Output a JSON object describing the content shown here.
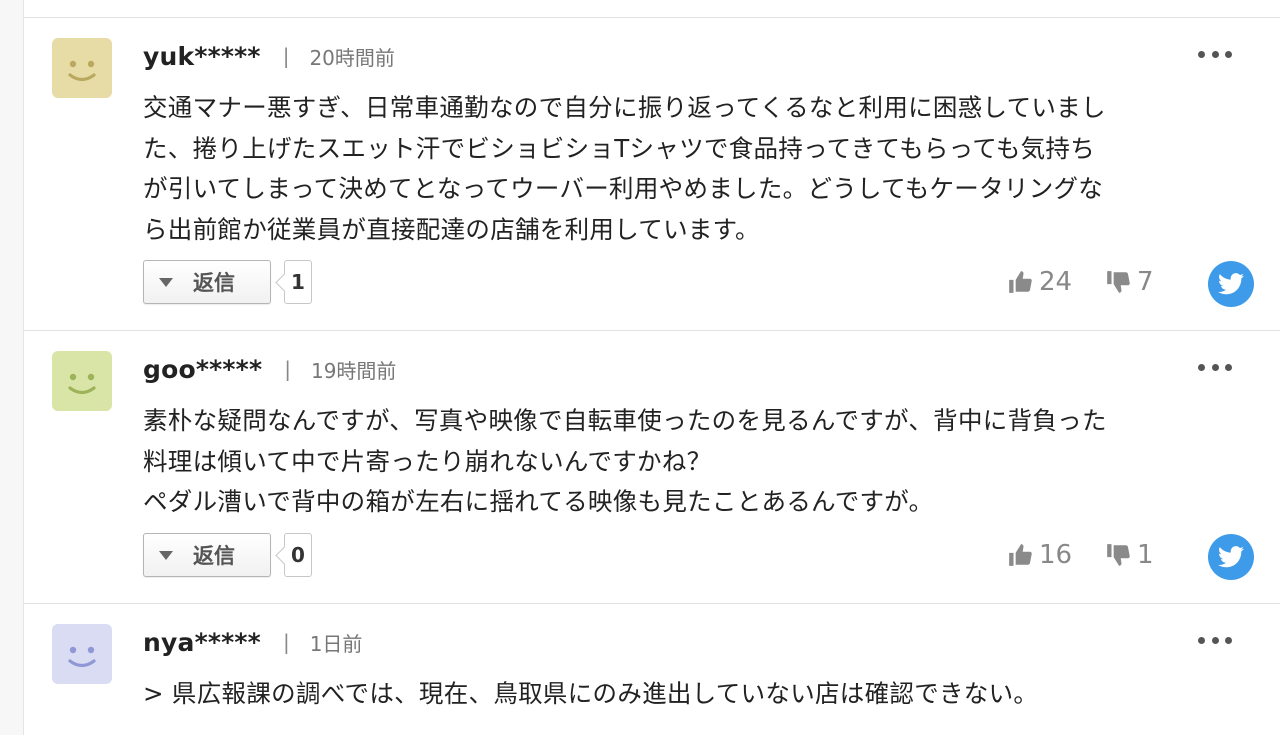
{
  "comments": [
    {
      "username": "yuk*****",
      "separator": "|",
      "time": "20時間前",
      "avatar_color": "#e8dca6",
      "avatar_face": "#b9a95e",
      "text_lines": [
        "交通マナー悪すぎ、日常車通勤なので自分に振り返ってくるなと利用に困惑していまし",
        "た、捲り上げたスエット汗でビショビショTシャツで食品持ってきてもらっても気持ち",
        "が引いてしまって決めてとなってウーバー利用やめました。どうしてもケータリングな",
        "ら出前館か従業員が直接配達の店舗を利用しています。"
      ],
      "reply_label": "返信",
      "reply_count": "1",
      "likes": "24",
      "dislikes": "7"
    },
    {
      "username": "goo*****",
      "separator": "|",
      "time": "19時間前",
      "avatar_color": "#d9e5a7",
      "avatar_face": "#9db35a",
      "text_lines": [
        "素朴な疑問なんですが、写真や映像で自転車使ったのを見るんですが、背中に背負った",
        "料理は傾いて中で片寄ったり崩れないんですかね？",
        "ペダル漕いで背中の箱が左右に揺れてる映像も見たことあるんですが。"
      ],
      "reply_label": "返信",
      "reply_count": "0",
      "likes": "16",
      "dislikes": "1"
    },
    {
      "username": "nya*****",
      "separator": "|",
      "time": "1日前",
      "avatar_color": "#d9dcf2",
      "avatar_face": "#8f98d4",
      "text_lines": [
        "> 県広報課の調べでは、現在、鳥取県にのみ進出していない店は確認できない。"
      ]
    }
  ],
  "icons": {
    "like": "thumbs-up-icon",
    "dislike": "thumbs-down-icon",
    "share": "twitter-icon",
    "more": "more-icon"
  },
  "colors": {
    "twitter": "#3d9bea",
    "vote": "#888888"
  }
}
